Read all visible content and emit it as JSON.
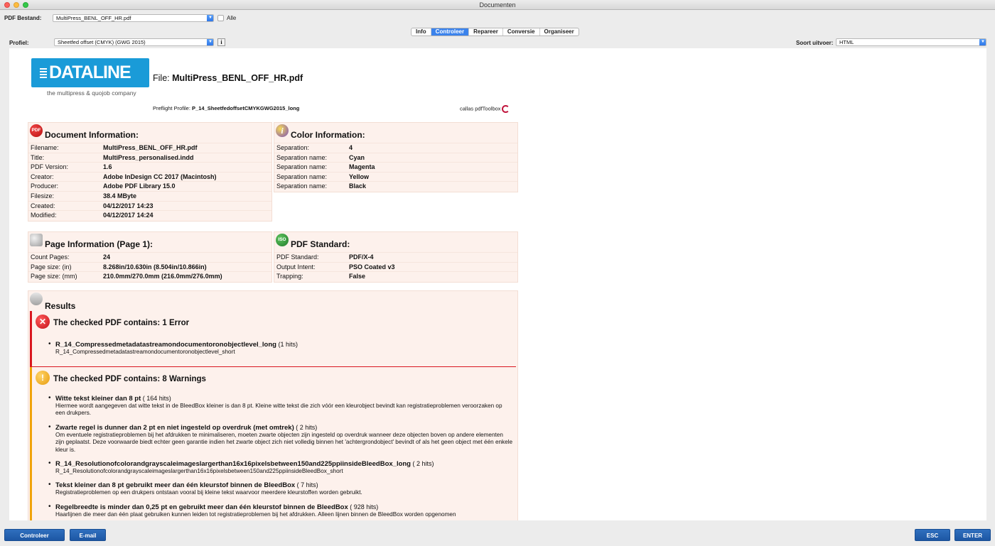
{
  "window": {
    "title": "Documenten"
  },
  "toolbar": {
    "pdf_label": "PDF Bestand:",
    "pdf_value": "MultiPress_BENL_OFF_HR.pdf",
    "all_label": "Alle",
    "profile_label": "Profiel:",
    "profile_value": "Sheetfed offset (CMYK) (GWG 2015)",
    "info_button": "i",
    "output_label": "Soort uitvoer:",
    "output_value": "HTML"
  },
  "tabs": [
    {
      "label": "Info",
      "active": false
    },
    {
      "label": "Controleer",
      "active": true
    },
    {
      "label": "Repareer",
      "active": false
    },
    {
      "label": "Conversie",
      "active": false
    },
    {
      "label": "Organiseer",
      "active": false
    }
  ],
  "report": {
    "logo_text": "DATALINE",
    "logo_tagline": "the multipress & quojob company",
    "file_label": "File:",
    "file_name": "MultiPress_BENL_OFF_HR.pdf",
    "preflight_label": "Preflight Profile:",
    "preflight_value": "P_14_SheetfedoffsetCMYKGWG2015_long",
    "callas_text": "callas pdfToolbox",
    "document_info": {
      "icon_text": "PDF",
      "title": "Document Information:",
      "rows": [
        {
          "k": "Filename:",
          "v": "MultiPress_BENL_OFF_HR.pdf"
        },
        {
          "k": "Title:",
          "v": "MultiPress_personalised.indd"
        },
        {
          "k": "PDF Version:",
          "v": "1.6"
        },
        {
          "k": "Creator:",
          "v": "Adobe InDesign CC 2017 (Macintosh)"
        },
        {
          "k": "Producer:",
          "v": "Adobe PDF Library 15.0"
        },
        {
          "k": "Filesize:",
          "v": "38.4 MByte"
        },
        {
          "k": "Created:",
          "v": "04/12/2017 14:23"
        },
        {
          "k": "Modified:",
          "v": "04/12/2017 14:24"
        }
      ]
    },
    "color_info": {
      "icon_text": "i",
      "title": "Color Information:",
      "rows": [
        {
          "k": "Separation:",
          "v": "4"
        },
        {
          "k": "Separation name:",
          "v": "Cyan"
        },
        {
          "k": "Separation name:",
          "v": "Magenta"
        },
        {
          "k": "Separation name:",
          "v": "Yellow"
        },
        {
          "k": "Separation name:",
          "v": "Black"
        }
      ]
    },
    "page_info": {
      "title": "Page Information (Page 1):",
      "rows": [
        {
          "k": "Count Pages:",
          "v": "24"
        },
        {
          "k": "Page size: (in)",
          "v": "8.268in/10.630in (8.504in/10.866in)"
        },
        {
          "k": "Page size: (mm)",
          "v": "210.0mm/270.0mm (216.0mm/276.0mm)"
        }
      ]
    },
    "pdf_standard": {
      "icon_text": "ISO",
      "title": "PDF Standard:",
      "rows": [
        {
          "k": "PDF Standard:",
          "v": "PDF/X-4"
        },
        {
          "k": "Output Intent:",
          "v": "PSO Coated v3"
        },
        {
          "k": "Trapping:",
          "v": "False"
        }
      ]
    },
    "results": {
      "title": "Results",
      "error": {
        "icon_text": "✕",
        "title": "The checked PDF contains: 1 Error",
        "items": [
          {
            "title": "R_14_Compressedmetadatastreamondocumentoronobjectlevel_long",
            "hits": " (1 hits)",
            "desc": "R_14_Compressedmetadatastreamondocumentoronobjectlevel_short"
          }
        ]
      },
      "warnings": {
        "icon_text": "!",
        "title": "The checked PDF contains: 8 Warnings",
        "items": [
          {
            "title": "Witte tekst kleiner dan 8 pt",
            "hits": " ( 164 hits)",
            "desc": "Hiermee wordt aangegeven dat witte tekst in de BleedBox kleiner is dan 8 pt. Kleine witte tekst die zich vóór een kleurobject bevindt kan registratieproblemen veroorzaken op een drukpers."
          },
          {
            "title": "Zwarte regel is dunner dan 2 pt en niet ingesteld op overdruk (met omtrek)",
            "hits": " ( 2 hits)",
            "desc": "Om eventuele registratieproblemen bij het afdrukken te minimaliseren, moeten zwarte objecten zijn ingesteld op overdruk wanneer deze objecten boven op andere elementen zijn geplaatst. Deze voorwaarde biedt echter geen garantie indien het zwarte object zich niet volledig binnen het 'achtergrondobject' bevindt of als het geen object met één enkele kleur is."
          },
          {
            "title": "R_14_Resolutionofcolorandgrayscaleimageslargerthan16x16pixelsbetween150and225ppiinsideBleedBox_long",
            "hits": " ( 2 hits)",
            "desc": "R_14_Resolutionofcolorandgrayscaleimageslargerthan16x16pixelsbetween150and225ppiinsideBleedBox_short"
          },
          {
            "title": "Tekst kleiner dan 8 pt gebruikt meer dan één kleurstof binnen de BleedBox",
            "hits": " ( 7 hits)",
            "desc": "Registratieproblemen op een drukpers ontstaan vooral bij kleine tekst waarvoor meerdere kleurstoffen worden gebruikt."
          },
          {
            "title": "Regelbreedte is minder dan 0,25 pt en gebruikt meer dan één kleurstof binnen de BleedBox",
            "hits": " ( 928 hits)",
            "desc": "Haarlijnen die meer dan één plaat gebruiken kunnen leiden tot registratieproblemen bij het afdrukken. Alleen lijnen binnen de BleedBox worden opgenomen"
          }
        ]
      }
    }
  },
  "buttons": {
    "check": "Controleer",
    "email": "E-mail",
    "esc": "ESC",
    "enter": "ENTER"
  },
  "colors": {
    "accent": "#3b83ec",
    "error": "#d9171f",
    "warning": "#f0a30a",
    "panel_bg": "#fdf1ec",
    "logo_bg": "#1a9bd8"
  }
}
